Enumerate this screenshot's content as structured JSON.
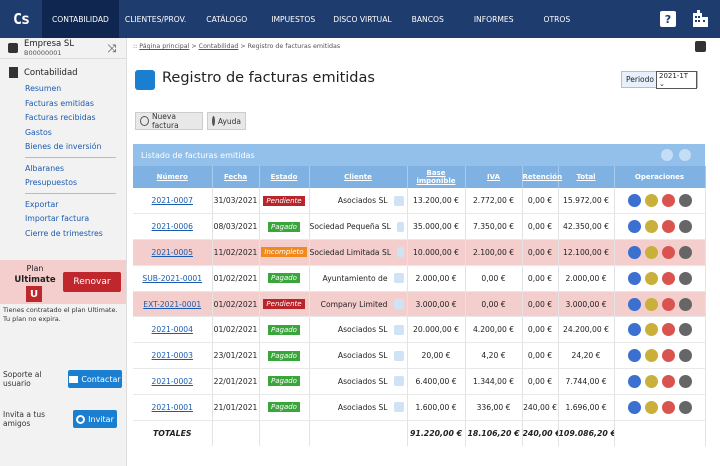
{
  "logo": "Cs",
  "nav": {
    "tabs": [
      "CONTABILIDAD",
      "CLIENTES/PROV.",
      "CATÁLOGO",
      "IMPUESTOS",
      "DISCO VIRTUAL",
      "BANCOS",
      "INFORMES",
      "OTROS"
    ],
    "help": "?"
  },
  "sidebar": {
    "company_name": "Empresa SL",
    "company_id": "B00000001",
    "section": "Contabilidad",
    "links1": [
      "Resumen",
      "Facturas emitidas",
      "Facturas recibidas",
      "Gastos",
      "Bienes de inversión"
    ],
    "links2": [
      "Albaranes",
      "Presupuestos"
    ],
    "links3": [
      "Exportar",
      "Importar factura",
      "Cierre de trimestres"
    ],
    "plan_label": "Plan",
    "plan_name": "Ultimate",
    "plan_badge": "U",
    "renew": "Renovar",
    "plan_note": "Tienes contratado el plan Ultimate. Tu plan no expira.",
    "support_text": "Soporte al usuario",
    "contact": "Contactar",
    "invite_text": "Invita a tus amigos",
    "invite": "Invitar"
  },
  "breadcrumb": {
    "home": "Página principal",
    "section": "Contabilidad",
    "current": "Registro de facturas emitidas"
  },
  "main": {
    "title": "Registro de facturas emitidas",
    "period_label": "Periodo",
    "period_value": "2021-1T",
    "new_invoice": "Nueva factura",
    "help": "Ayuda",
    "table_title": "Listado de facturas emitidas"
  },
  "colors": {
    "nav": "#1f3c6e",
    "accent": "#1a7fd0",
    "paid": "#3aa53a",
    "pending": "#b8252b",
    "incomplete": "#f08a1c",
    "row_highlight": "#f4cdcd"
  },
  "table": {
    "headers": [
      "Número",
      "Fecha",
      "Estado",
      "Cliente",
      "Base imponible",
      "IVA",
      "Retención",
      "Total",
      "Operaciones"
    ],
    "rows": [
      {
        "numero": "2021-0007",
        "fecha": "31/03/2021",
        "estado": "Pendiente",
        "cliente": "Asociados SL",
        "base": "13.200,00 €",
        "iva": "2.772,00 €",
        "ret": "0,00 €",
        "total": "15.972,00 €",
        "highlight": false
      },
      {
        "numero": "2021-0006",
        "fecha": "08/03/2021",
        "estado": "Pagado",
        "cliente": "Sociedad Pequeña SL",
        "base": "35.000,00 €",
        "iva": "7.350,00 €",
        "ret": "0,00 €",
        "total": "42.350,00 €",
        "highlight": false
      },
      {
        "numero": "2021-0005",
        "fecha": "11/02/2021",
        "estado": "Incompleto",
        "cliente": "Sociedad Limitada SL",
        "base": "10.000,00 €",
        "iva": "2.100,00 €",
        "ret": "0,00 €",
        "total": "12.100,00 €",
        "highlight": true
      },
      {
        "numero": "SUB-2021-0001",
        "fecha": "01/02/2021",
        "estado": "Pagado",
        "cliente": "Ayuntamiento de",
        "base": "2.000,00 €",
        "iva": "0,00 €",
        "ret": "0,00 €",
        "total": "2.000,00 €",
        "highlight": false
      },
      {
        "numero": "EXT-2021-0001",
        "fecha": "01/02/2021",
        "estado": "Pendiente",
        "cliente": "Company Limited",
        "base": "3.000,00 €",
        "iva": "0,00 €",
        "ret": "0,00 €",
        "total": "3.000,00 €",
        "highlight": true
      },
      {
        "numero": "2021-0004",
        "fecha": "01/02/2021",
        "estado": "Pagado",
        "cliente": "Asociados SL",
        "base": "20.000,00 €",
        "iva": "4.200,00 €",
        "ret": "0,00 €",
        "total": "24.200,00 €",
        "highlight": false
      },
      {
        "numero": "2021-0003",
        "fecha": "23/01/2021",
        "estado": "Pagado",
        "cliente": "Asociados SL",
        "base": "20,00 €",
        "iva": "4,20 €",
        "ret": "0,00 €",
        "total": "24,20 €",
        "highlight": false
      },
      {
        "numero": "2021-0002",
        "fecha": "22/01/2021",
        "estado": "Pagado",
        "cliente": "Asociados SL",
        "base": "6.400,00 €",
        "iva": "1.344,00 €",
        "ret": "0,00 €",
        "total": "7.744,00 €",
        "highlight": false
      },
      {
        "numero": "2021-0001",
        "fecha": "21/01/2021",
        "estado": "Pagado",
        "cliente": "Asociados SL",
        "base": "1.600,00 €",
        "iva": "336,00 €",
        "ret": "240,00 €",
        "total": "1.696,00 €",
        "highlight": false
      }
    ],
    "totals": {
      "label": "TOTALES",
      "base": "91.220,00 €",
      "iva": "18.106,20 €",
      "ret": "240,00 €",
      "total": "109.086,20 €"
    }
  }
}
